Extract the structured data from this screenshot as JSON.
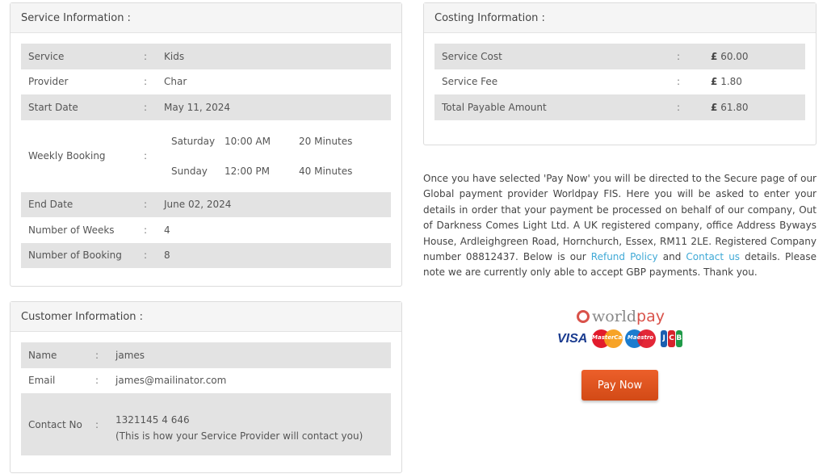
{
  "service_info": {
    "title": "Service Information :",
    "rows": [
      {
        "label": "Service",
        "value": "Kids"
      },
      {
        "label": "Provider",
        "value": "Char"
      },
      {
        "label": "Start Date",
        "value": "May 11, 2024"
      }
    ],
    "weekly_booking": {
      "label": "Weekly Booking",
      "schedule": [
        {
          "day": "Saturday",
          "time": "10:00 AM",
          "duration": "20 Minutes"
        },
        {
          "day": "Sunday",
          "time": "12:00 PM",
          "duration": "40 Minutes"
        }
      ]
    },
    "rows_after": [
      {
        "label": "End Date",
        "value": "June 02, 2024"
      },
      {
        "label": "Number of Weeks",
        "value": "4"
      },
      {
        "label": "Number of Booking",
        "value": "8"
      }
    ],
    "separator": ":"
  },
  "customer_info": {
    "title": "Customer Information :",
    "name": {
      "label": "Name",
      "value": "james"
    },
    "email": {
      "label": "Email",
      "value": "james@mailinator.com"
    },
    "contact": {
      "label": "Contact No",
      "value": "1321145 4 646",
      "note": "(This is how your Service Provider will contact you)"
    }
  },
  "costing_info": {
    "title": "Costing Information :",
    "currency_symbol": "£",
    "rows": [
      {
        "label": "Service Cost",
        "value": "60.00"
      },
      {
        "label": "Service Fee",
        "value": "1.80"
      },
      {
        "label": "Total Payable Amount",
        "value": "61.80"
      }
    ]
  },
  "payment_notice": {
    "text_before_refund": "Once you have selected 'Pay Now' you will be directed to the Secure page of our Global payment provider Worldpay FIS. Here you will be asked to enter your details in order that your payment be processed on behalf of our company, Out of Darkness Comes Light Ltd. A UK registered company, office Address Byways House, Ardleighgreen Road, Hornchurch, Essex, RM11 2LE. Registered Company number 08812437. Below is our ",
    "refund_link": "Refund Policy",
    "text_between": " and ",
    "contact_link": "Contact us",
    "text_after": " details. Please note we are currently only able to accept GBP payments. Thank you."
  },
  "payment_logos": {
    "brand_world": "world",
    "brand_pay": "pay",
    "visa": "VISA",
    "mastercard": "MasterCard",
    "maestro": "Maestro",
    "jcb": [
      "J",
      "C",
      "B"
    ]
  },
  "pay_now_label": "Pay Now",
  "colors": {
    "accent_button": "#e05420",
    "link": "#3fa9d6",
    "row_shade": "#e3e3e3"
  }
}
